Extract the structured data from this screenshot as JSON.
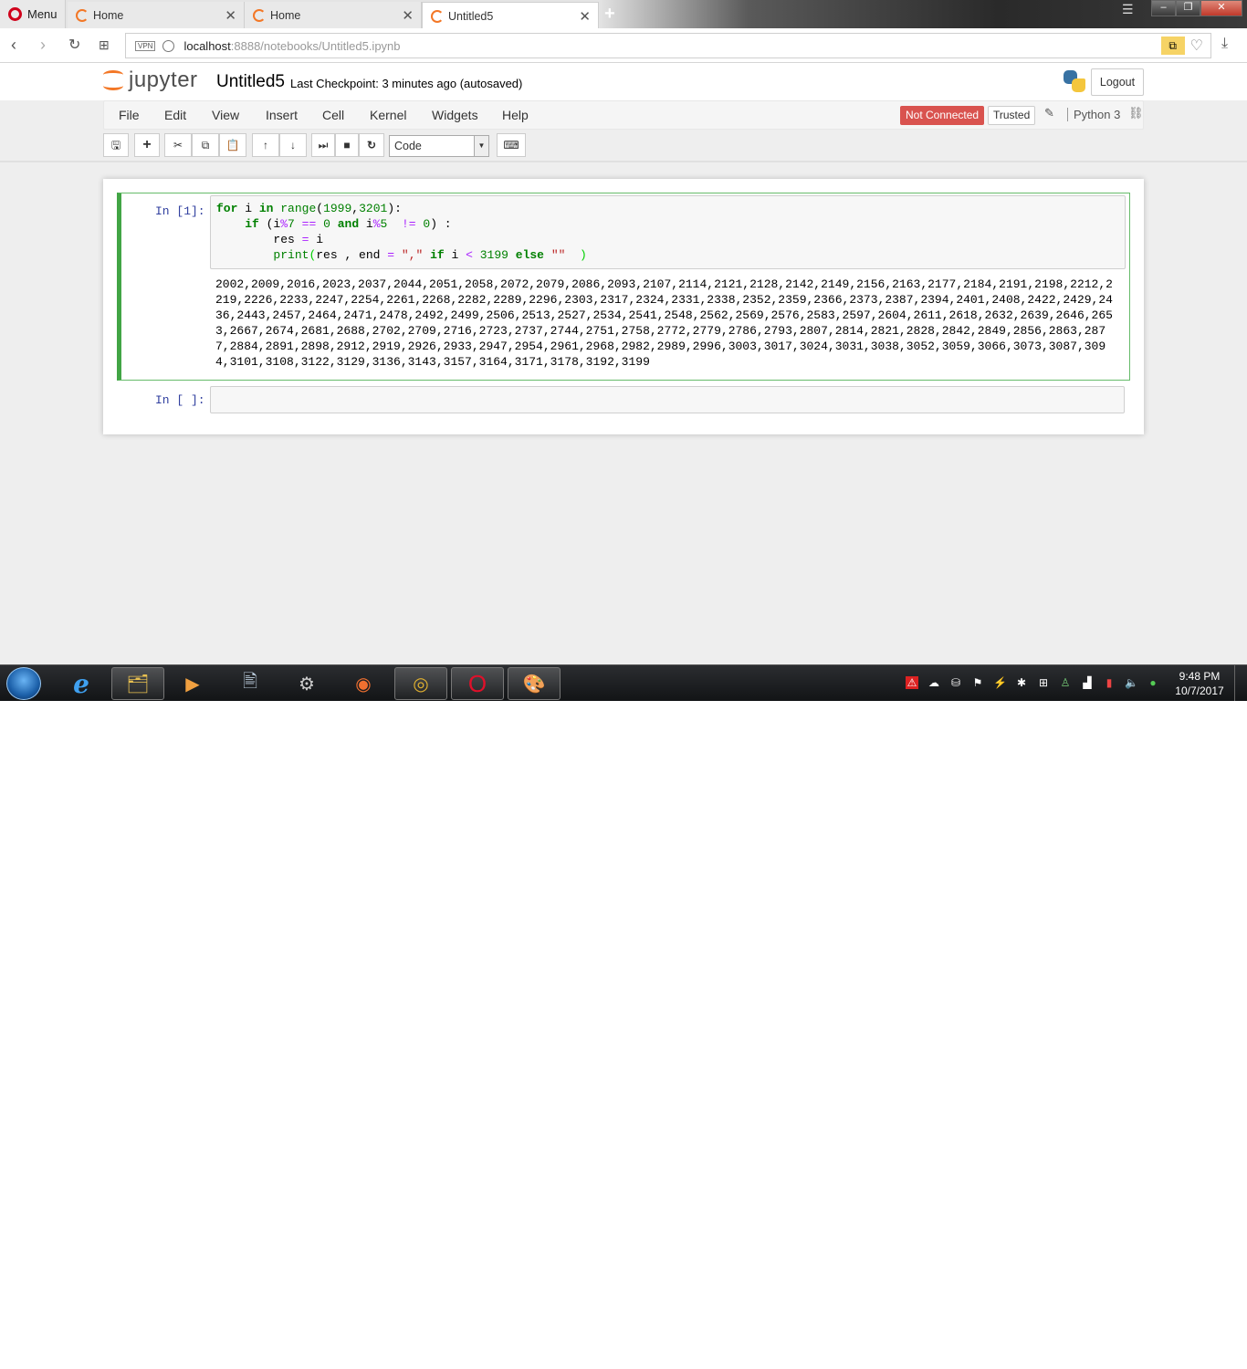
{
  "browser": {
    "menu_label": "Menu",
    "tabs": [
      {
        "title": "Home"
      },
      {
        "title": "Home"
      },
      {
        "title": "Untitled5"
      }
    ],
    "url_host": "localhost",
    "url_rest": ":8888/notebooks/Untitled5.ipynb",
    "vpn_label": "VPN"
  },
  "header": {
    "logo_text": "jupyter",
    "notebook_name": "Untitled5",
    "checkpoint": "Last Checkpoint: 3 minutes ago (autosaved)",
    "logout_label": "Logout"
  },
  "menubar": {
    "items": [
      "File",
      "Edit",
      "View",
      "Insert",
      "Cell",
      "Kernel",
      "Widgets",
      "Help"
    ],
    "kernel_status": "Not Connected",
    "trusted_label": "Trusted",
    "kernel_name": "Python 3"
  },
  "toolbar": {
    "cell_type": "Code"
  },
  "cells": [
    {
      "prompt": "In [1]:",
      "code_lines": [
        "for i in range(1999,3201):",
        "    if (i%7 == 0 and i%5  != 0) :",
        "        res = i",
        "        print(res , end = \",\" if i < 3199 else \"\"  )"
      ],
      "output": "2002,2009,2016,2023,2037,2044,2051,2058,2072,2079,2086,2093,2107,2114,2121,2128,2142,2149,2156,2163,2177,2184,2191,2198,2212,2219,2226,2233,2247,2254,2261,2268,2282,2289,2296,2303,2317,2324,2331,2338,2352,2359,2366,2373,2387,2394,2401,2408,2422,2429,2436,2443,2457,2464,2471,2478,2492,2499,2506,2513,2527,2534,2541,2548,2562,2569,2576,2583,2597,2604,2611,2618,2632,2639,2646,2653,2667,2674,2681,2688,2702,2709,2716,2723,2737,2744,2751,2758,2772,2779,2786,2793,2807,2814,2821,2828,2842,2849,2856,2863,2877,2884,2891,2898,2912,2919,2926,2933,2947,2954,2961,2968,2982,2989,2996,3003,3017,3024,3031,3038,3052,3059,3066,3073,3087,3094,3101,3108,3122,3129,3136,3143,3157,3164,3171,3178,3192,3199"
    },
    {
      "prompt": "In [ ]:"
    }
  ],
  "taskbar": {
    "time": "9:48 PM",
    "date": "10/7/2017"
  }
}
